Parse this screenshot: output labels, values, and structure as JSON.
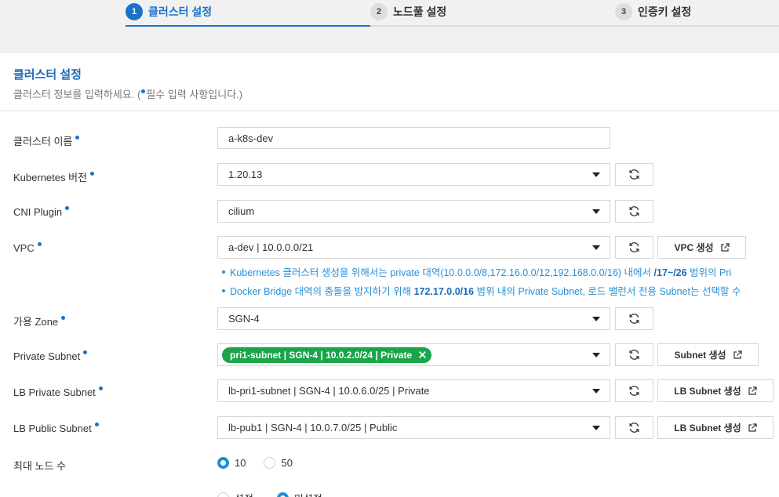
{
  "stepper": {
    "steps": [
      {
        "num": "1",
        "label": "클러스터 설정"
      },
      {
        "num": "2",
        "label": "노드풀 설정"
      },
      {
        "num": "3",
        "label": "인증키 설정"
      }
    ]
  },
  "section": {
    "title": "클러스터 설정",
    "desc_prefix": "클러스터 정보를 입력하세요. (",
    "desc_suffix": "필수 입력 사항입니다.)"
  },
  "form": {
    "cluster_name": {
      "label": "클러스터 이름",
      "value": "a-k8s-dev"
    },
    "k8s_version": {
      "label": "Kubernetes 버전",
      "value": "1.20.13"
    },
    "cni": {
      "label": "CNI Plugin",
      "value": "cilium"
    },
    "vpc": {
      "label": "VPC",
      "value": "a-dev | 10.0.0.0/21",
      "create_label": "VPC 생성"
    },
    "vpc_hints": {
      "hint1_a": "Kubernetes 클러스터 생성을 위해서는 private 대역(10.0.0.0/8,172.16.0.0/12,192.168.0.0/16) 내에서 ",
      "hint1_b": "/17~/26",
      "hint1_c": " 범위의 Pri",
      "hint2_a": "Docker Bridge 대역의 충돌을 방지하기 위해 ",
      "hint2_b": "172.17.0.0/16",
      "hint2_c": " 범위 내의 Private Subnet, 로드 밸런서 전용 Subnet는 선택할 수"
    },
    "zone": {
      "label": "가용 Zone",
      "value": "SGN-4"
    },
    "private_subnet": {
      "label": "Private Subnet",
      "tag": "pri1-subnet | SGN-4 | 10.0.2.0/24 | Private",
      "create_label": "Subnet 생성"
    },
    "lb_private_subnet": {
      "label": "LB Private Subnet",
      "value": "lb-pri1-subnet | SGN-4 | 10.0.6.0/25 | Private",
      "create_label": "LB Subnet 생성"
    },
    "lb_public_subnet": {
      "label": "LB Public Subnet",
      "value": "lb-pub1 | SGN-4 | 10.0.7.0/25 | Public",
      "create_label": "LB Subnet 생성"
    },
    "max_nodes": {
      "label": "최대 노드 수",
      "options": [
        "10",
        "50"
      ],
      "selected": "10"
    },
    "last_row": {
      "options": [
        "설정",
        "미설정"
      ],
      "selected": "미설정"
    }
  },
  "colors": {
    "accent": "#1a73c9",
    "tag_green": "#1aa54a",
    "hint_blue": "#2a8fd6"
  }
}
